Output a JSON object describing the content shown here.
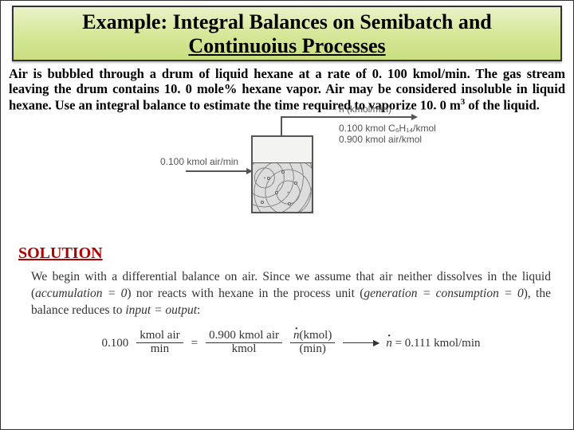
{
  "title": {
    "line1": "Example: Integral Balances on Semibatch and",
    "line2": "Continuoius Processes"
  },
  "problem": {
    "p1a": "Air is bubbled through a drum of liquid hexane at a rate of 0. 100 kmol/min. The gas stream leaving the drum contains 10. 0 mole% hexane vapor. Air may be considered insoluble in liquid hexane. Use an integral balance to estimate the time required to vaporize 10. 0 m",
    "p1sup": "3",
    "p1b": " of the liquid."
  },
  "diagram": {
    "inlet": "0.100 kmol air/min",
    "ndot": "ṅ (kmol/min)",
    "out1": "0.100 kmol C₆H₁₄/kmol",
    "out2": "0.900 kmol air/kmol"
  },
  "solution": {
    "header": "SOLUTION",
    "lead_a": "We begin with a differential balance on air. Since we assume that air neither dissolves in the liquid (",
    "lead_acc": "accumulation = 0",
    "lead_b": ") nor reacts with hexane in the process unit (",
    "lead_gen": "generation = consumption = 0",
    "lead_c": "), the balance reduces to ",
    "lead_io": "input = output",
    "lead_d": ":"
  },
  "equation": {
    "lhs_coef": "0.100",
    "lhs_num": "kmol air",
    "lhs_den": "min",
    "eq": "=",
    "f1_num": "0.900 kmol air",
    "f1_den": "kmol",
    "dot": "·",
    "f2_num_var": "n",
    "f2_num_unit": "(kmol)",
    "f2_den": "(min)",
    "result_var": "n",
    "result_val": " = 0.111 kmol/min"
  }
}
